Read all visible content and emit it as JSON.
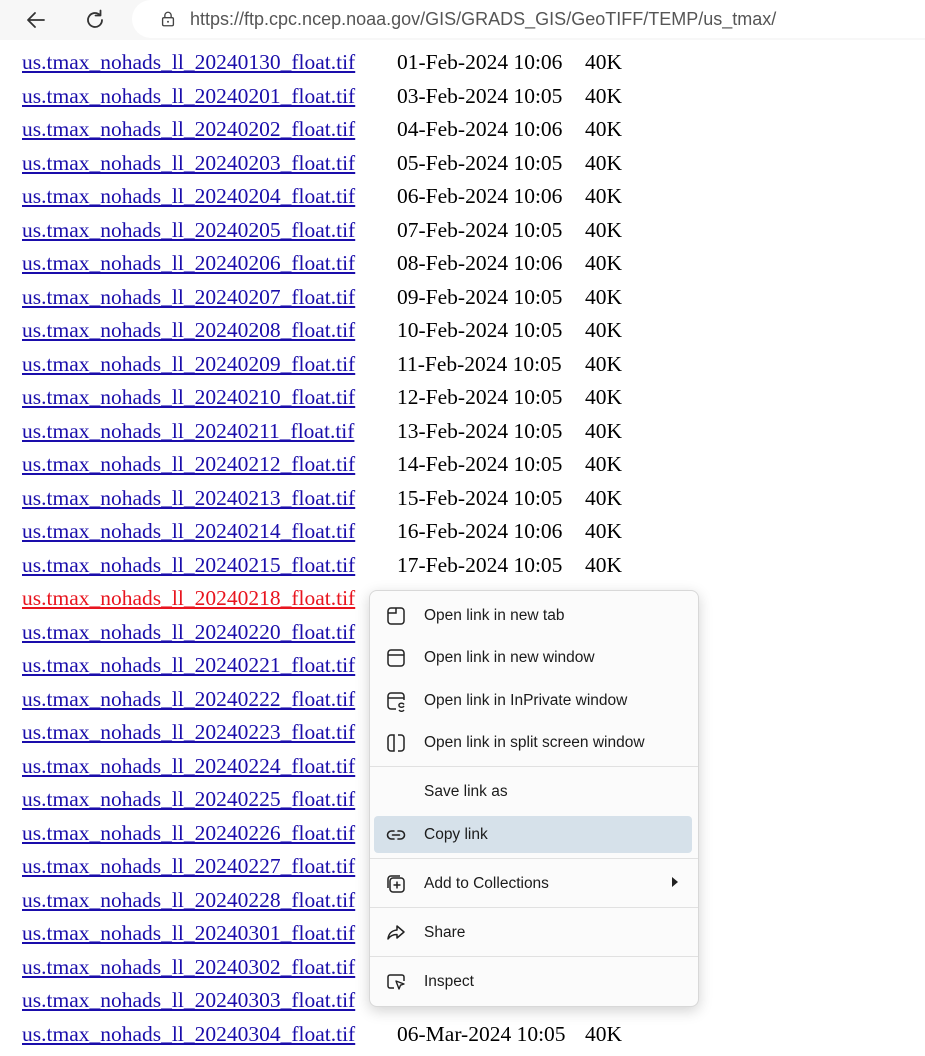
{
  "browser": {
    "url": "https://ftp.cpc.ncep.noaa.gov/GIS/GRADS_GIS/GeoTIFF/TEMP/us_tmax/"
  },
  "listing": [
    {
      "name": "us.tmax_nohads_ll_20240130_float.tif",
      "date": "01-Feb-2024 10:06",
      "size": "40K"
    },
    {
      "name": "us.tmax_nohads_ll_20240201_float.tif",
      "date": "03-Feb-2024 10:05",
      "size": "40K"
    },
    {
      "name": "us.tmax_nohads_ll_20240202_float.tif",
      "date": "04-Feb-2024 10:06",
      "size": "40K"
    },
    {
      "name": "us.tmax_nohads_ll_20240203_float.tif",
      "date": "05-Feb-2024 10:05",
      "size": "40K"
    },
    {
      "name": "us.tmax_nohads_ll_20240204_float.tif",
      "date": "06-Feb-2024 10:06",
      "size": "40K"
    },
    {
      "name": "us.tmax_nohads_ll_20240205_float.tif",
      "date": "07-Feb-2024 10:05",
      "size": "40K"
    },
    {
      "name": "us.tmax_nohads_ll_20240206_float.tif",
      "date": "08-Feb-2024 10:06",
      "size": "40K"
    },
    {
      "name": "us.tmax_nohads_ll_20240207_float.tif",
      "date": "09-Feb-2024 10:05",
      "size": "40K"
    },
    {
      "name": "us.tmax_nohads_ll_20240208_float.tif",
      "date": "10-Feb-2024 10:05",
      "size": "40K"
    },
    {
      "name": "us.tmax_nohads_ll_20240209_float.tif",
      "date": "11-Feb-2024 10:05",
      "size": "40K"
    },
    {
      "name": "us.tmax_nohads_ll_20240210_float.tif",
      "date": "12-Feb-2024 10:05",
      "size": "40K"
    },
    {
      "name": "us.tmax_nohads_ll_20240211_float.tif",
      "date": "13-Feb-2024 10:05",
      "size": "40K"
    },
    {
      "name": "us.tmax_nohads_ll_20240212_float.tif",
      "date": "14-Feb-2024 10:05",
      "size": "40K"
    },
    {
      "name": "us.tmax_nohads_ll_20240213_float.tif",
      "date": "15-Feb-2024 10:05",
      "size": "40K"
    },
    {
      "name": "us.tmax_nohads_ll_20240214_float.tif",
      "date": "16-Feb-2024 10:06",
      "size": "40K"
    },
    {
      "name": "us.tmax_nohads_ll_20240215_float.tif",
      "date": "17-Feb-2024 10:05",
      "size": "40K"
    },
    {
      "name": "us.tmax_nohads_ll_20240218_float.tif",
      "date": "",
      "size": "",
      "active": true
    },
    {
      "name": "us.tmax_nohads_ll_20240220_float.tif",
      "date": "",
      "size": ""
    },
    {
      "name": "us.tmax_nohads_ll_20240221_float.tif",
      "date": "",
      "size": ""
    },
    {
      "name": "us.tmax_nohads_ll_20240222_float.tif",
      "date": "",
      "size": ""
    },
    {
      "name": "us.tmax_nohads_ll_20240223_float.tif",
      "date": "",
      "size": ""
    },
    {
      "name": "us.tmax_nohads_ll_20240224_float.tif",
      "date": "",
      "size": ""
    },
    {
      "name": "us.tmax_nohads_ll_20240225_float.tif",
      "date": "",
      "size": ""
    },
    {
      "name": "us.tmax_nohads_ll_20240226_float.tif",
      "date": "",
      "size": ""
    },
    {
      "name": "us.tmax_nohads_ll_20240227_float.tif",
      "date": "",
      "size": ""
    },
    {
      "name": "us.tmax_nohads_ll_20240228_float.tif",
      "date": "",
      "size": ""
    },
    {
      "name": "us.tmax_nohads_ll_20240301_float.tif",
      "date": "",
      "size": ""
    },
    {
      "name": "us.tmax_nohads_ll_20240302_float.tif",
      "date": "",
      "size": ""
    },
    {
      "name": "us.tmax_nohads_ll_20240303_float.tif",
      "date": "",
      "size": ""
    },
    {
      "name": "us.tmax_nohads_ll_20240304_float.tif",
      "date": "06-Mar-2024 10:05",
      "size": "40K"
    }
  ],
  "context_menu": {
    "items": [
      {
        "label": "Open link in new tab",
        "icon": "new-tab-icon"
      },
      {
        "label": "Open link in new window",
        "icon": "new-window-icon"
      },
      {
        "label": "Open link in InPrivate window",
        "icon": "inprivate-window-icon"
      },
      {
        "label": "Open link in split screen window",
        "icon": "split-screen-icon"
      },
      {
        "label": "Save link as",
        "icon": ""
      },
      {
        "label": "Copy link",
        "icon": "link-icon",
        "highlighted": true
      },
      {
        "label": "Add to Collections",
        "icon": "collections-icon",
        "submenu": true
      },
      {
        "label": "Share",
        "icon": "share-icon"
      },
      {
        "label": "Inspect",
        "icon": "inspect-icon"
      }
    ]
  },
  "colors": {
    "link": "#1a0dab",
    "active_link": "#e8141e",
    "menu_highlight": "#d6e1ea"
  }
}
